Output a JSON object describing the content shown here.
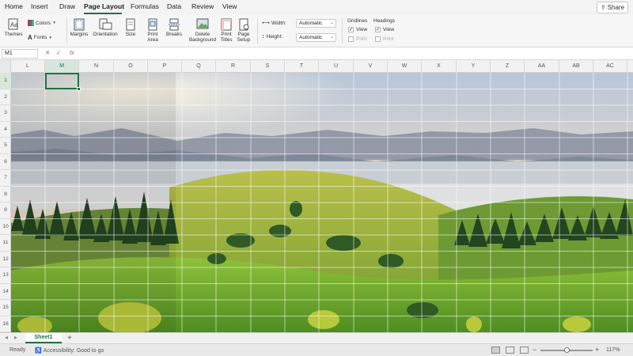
{
  "menu": {
    "tabs": [
      "Home",
      "Insert",
      "Draw",
      "Page Layout",
      "Formulas",
      "Data",
      "Review",
      "View"
    ],
    "share_label": "Share"
  },
  "ribbon": {
    "themes": "Themes",
    "colors": "Colors",
    "fonts": "Fonts",
    "margins": "Margins",
    "orientation": "Orientation",
    "size": "Size",
    "print_area_1": "Print",
    "print_area_2": "Area",
    "breaks": "Breaks",
    "delete_bg_1": "Delete",
    "delete_bg_2": "Background",
    "print_titles_1": "Print",
    "print_titles_2": "Titles",
    "page_setup_1": "Page",
    "page_setup_2": "Setup",
    "width_label": "Width:",
    "width_value": "Automatic",
    "height_label": "Height:",
    "height_value": "Automatic",
    "gridlines_label": "Gridlines",
    "headings_label": "Headings",
    "view_label": "View",
    "print_label": "Print"
  },
  "formula_bar": {
    "name_box": "M1",
    "fx": "fx"
  },
  "grid": {
    "columns": [
      "L",
      "M",
      "N",
      "O",
      "P",
      "Q",
      "R",
      "S",
      "T",
      "U",
      "V",
      "W",
      "X",
      "Y",
      "Z",
      "AA",
      "AB",
      "AC"
    ],
    "rows": [
      "1",
      "2",
      "3",
      "4",
      "5",
      "6",
      "7",
      "8",
      "9",
      "10",
      "11",
      "12",
      "13",
      "14",
      "15",
      "16"
    ]
  },
  "sheets": {
    "active": "Sheet1",
    "add": "+"
  },
  "status": {
    "ready": "Ready",
    "accessibility": "Accessibility: Good to go",
    "zoom": "117%"
  },
  "colors": {
    "accent": "#1e7145"
  }
}
